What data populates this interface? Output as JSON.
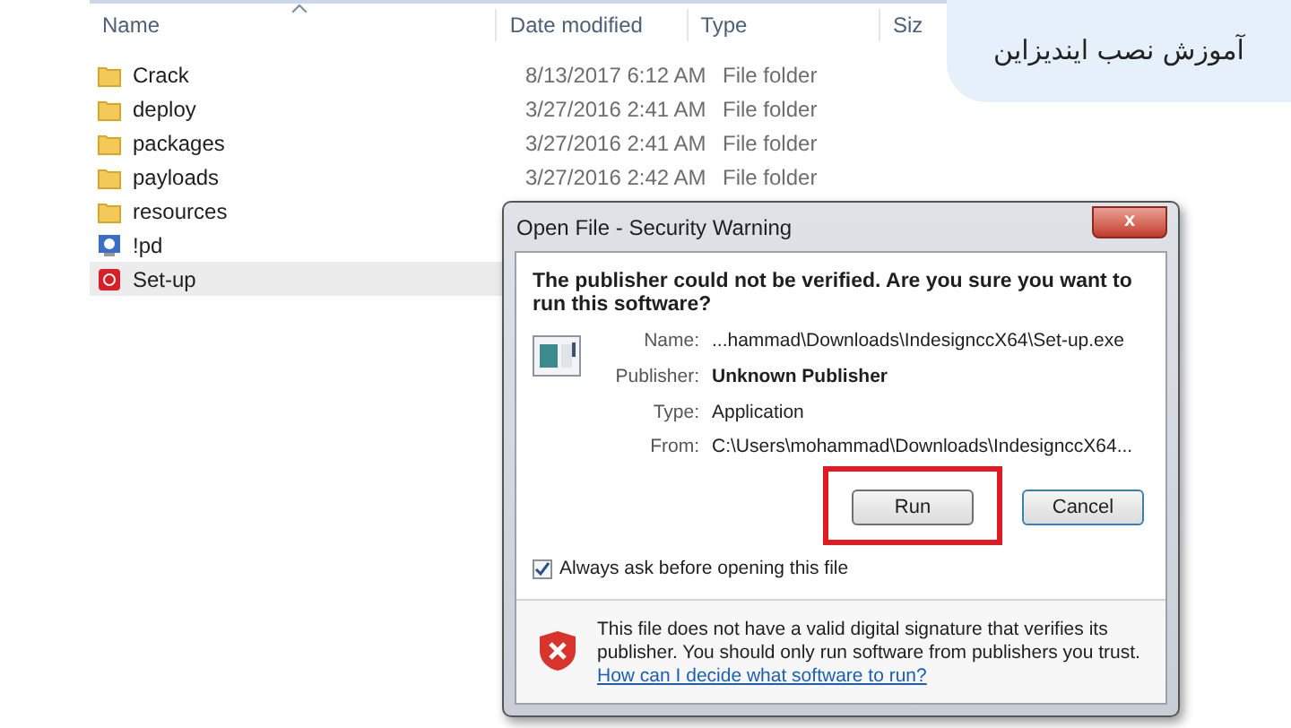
{
  "explorer": {
    "columns": [
      {
        "label": "Name"
      },
      {
        "label": "Date modified"
      },
      {
        "label": "Type"
      },
      {
        "label": "Siz"
      }
    ],
    "rows": [
      {
        "name": "Crack",
        "kind": "folder",
        "date": "8/13/2017 6:12 AM",
        "type": "File folder",
        "selected": false
      },
      {
        "name": "deploy",
        "kind": "folder",
        "date": "3/27/2016 2:41 AM",
        "type": "File folder",
        "selected": false
      },
      {
        "name": "packages",
        "kind": "folder",
        "date": "3/27/2016 2:41 AM",
        "type": "File folder",
        "selected": false
      },
      {
        "name": "payloads",
        "kind": "folder",
        "date": "3/27/2016 2:42 AM",
        "type": "File folder",
        "selected": false
      },
      {
        "name": "resources",
        "kind": "folder",
        "selected": false
      },
      {
        "name": "!pd",
        "kind": "app",
        "selected": false
      },
      {
        "name": "Set-up",
        "kind": "setup",
        "selected": true
      }
    ]
  },
  "banner": {
    "title": "آموزش نصب ایندیزاین"
  },
  "dialog": {
    "title": "Open File - Security Warning",
    "close": "x",
    "question": "The publisher could not be verified.  Are you sure you want to run this software?",
    "fields": [
      {
        "label": "Name:",
        "value": "...hammad\\Downloads\\IndesignccX64\\Set-up.exe",
        "bold": false
      },
      {
        "label": "Publisher:",
        "value": "Unknown Publisher",
        "bold": true
      },
      {
        "label": "Type:",
        "value": "Application",
        "bold": false
      },
      {
        "label": "From:",
        "value": "C:\\Users\\mohammad\\Downloads\\IndesignccX64...",
        "bold": false
      }
    ],
    "buttons": [
      {
        "label": "Run",
        "highlighted": true
      },
      {
        "label": "Cancel",
        "highlighted": false
      }
    ],
    "checkbox": {
      "label": "Always ask before opening this file",
      "checked": true
    },
    "warning": "This file does not have a valid digital signature that verifies its publisher.  You should only run software from publishers you trust.",
    "link": "How can I decide what software to run?"
  }
}
